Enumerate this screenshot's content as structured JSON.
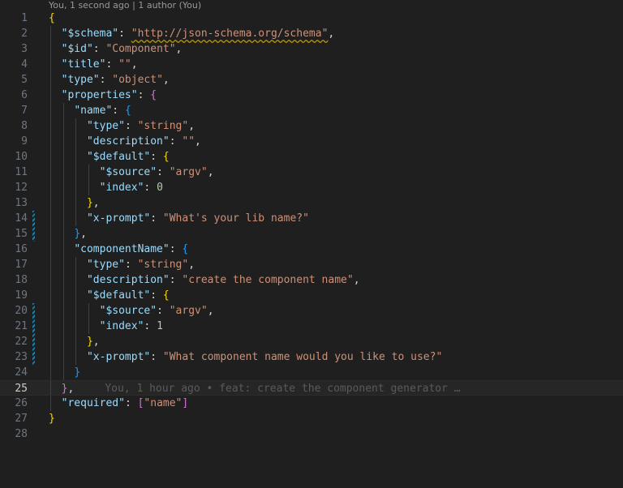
{
  "codelens": {
    "blame": "You, 1 second ago | 1 author (You)"
  },
  "editor": {
    "line_numbers": [
      "1",
      "2",
      "3",
      "4",
      "5",
      "6",
      "7",
      "8",
      "9",
      "10",
      "11",
      "12",
      "13",
      "14",
      "15",
      "16",
      "17",
      "18",
      "19",
      "20",
      "21",
      "22",
      "23",
      "24",
      "25",
      "26",
      "27",
      "28"
    ],
    "active_line": "25",
    "inline_blame": "You, 1 hour ago • feat: create the component generator …",
    "code": {
      "schema_key": "\"$schema\"",
      "schema_val": "\"http://json-schema.org/schema\"",
      "id_key": "\"$id\"",
      "id_val": "\"Component\"",
      "title_key": "\"title\"",
      "title_val": "\"\"",
      "type_key": "\"type\"",
      "type_val": "\"object\"",
      "properties_key": "\"properties\"",
      "name_key": "\"name\"",
      "name_type_key": "\"type\"",
      "name_type_val": "\"string\"",
      "name_desc_key": "\"description\"",
      "name_desc_val": "\"\"",
      "name_default_key": "\"$default\"",
      "name_source_key": "\"$source\"",
      "name_source_val": "\"argv\"",
      "name_index_key": "\"index\"",
      "name_index_val": "0",
      "name_prompt_key": "\"x-prompt\"",
      "name_prompt_val": "\"What's your lib name?\"",
      "cn_key": "\"componentName\"",
      "cn_type_key": "\"type\"",
      "cn_type_val": "\"string\"",
      "cn_desc_key": "\"description\"",
      "cn_desc_val": "\"create the component name\"",
      "cn_default_key": "\"$default\"",
      "cn_source_key": "\"$source\"",
      "cn_source_val": "\"argv\"",
      "cn_index_key": "\"index\"",
      "cn_index_val": "1",
      "cn_prompt_key": "\"x-prompt\"",
      "cn_prompt_val": "\"What component name would you like to use?\"",
      "required_key": "\"required\"",
      "required_val": "\"name\""
    }
  },
  "colors": {
    "background": "#1f1f1f",
    "key": "#9cdcfe",
    "string": "#ce9178",
    "number": "#b5cea8",
    "bracket_level1": "#ffd700",
    "bracket_level2": "#da70d6",
    "bracket_level3": "#179fff",
    "modified_gutter": "#1b81a8"
  }
}
